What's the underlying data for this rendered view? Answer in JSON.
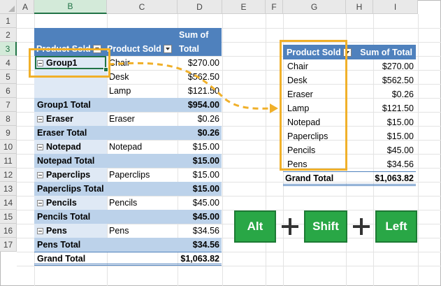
{
  "columns": [
    "A",
    "B",
    "C",
    "D",
    "E",
    "F",
    "G",
    "H",
    "I"
  ],
  "rows": [
    "1",
    "2",
    "3",
    "4",
    "5",
    "6",
    "7",
    "8",
    "9",
    "10",
    "11",
    "12",
    "13",
    "14",
    "15",
    "16",
    "17"
  ],
  "pivot1": {
    "header_row_label": "Product Sold",
    "header_col_label": "Product Sold",
    "header_value_label_1": "Sum of",
    "header_value_label_2": "Total",
    "rows": [
      {
        "b": "Group1",
        "c": "Chair",
        "d": "$270.00",
        "kind": "group"
      },
      {
        "b": "",
        "c": "Desk",
        "d": "$562.50",
        "kind": "item"
      },
      {
        "b": "",
        "c": "Lamp",
        "d": "$121.50",
        "kind": "item"
      },
      {
        "b": "Group1 Total",
        "c": "",
        "d": "$954.00",
        "kind": "total"
      },
      {
        "b": "Eraser",
        "c": "Eraser",
        "d": "$0.26",
        "kind": "group"
      },
      {
        "b": "Eraser Total",
        "c": "",
        "d": "$0.26",
        "kind": "total"
      },
      {
        "b": "Notepad",
        "c": "Notepad",
        "d": "$15.00",
        "kind": "group"
      },
      {
        "b": "Notepad Total",
        "c": "",
        "d": "$15.00",
        "kind": "total"
      },
      {
        "b": "Paperclips",
        "c": "Paperclips",
        "d": "$15.00",
        "kind": "group"
      },
      {
        "b": "Paperclips Total",
        "c": "",
        "d": "$15.00",
        "kind": "total"
      },
      {
        "b": "Pencils",
        "c": "Pencils",
        "d": "$45.00",
        "kind": "group"
      },
      {
        "b": "Pencils Total",
        "c": "",
        "d": "$45.00",
        "kind": "total"
      },
      {
        "b": "Pens",
        "c": "Pens",
        "d": "$34.56",
        "kind": "group"
      },
      {
        "b": "Pens Total",
        "c": "",
        "d": "$34.56",
        "kind": "total"
      },
      {
        "b": "Grand Total",
        "c": "",
        "d": "$1,063.82",
        "kind": "grand"
      }
    ]
  },
  "pivot2": {
    "header_row_label": "Product Sold",
    "header_value_label": "Sum of Total",
    "rows": [
      {
        "label": "Chair",
        "value": "$270.00"
      },
      {
        "label": "Desk",
        "value": "$562.50"
      },
      {
        "label": "Eraser",
        "value": "$0.26"
      },
      {
        "label": "Lamp",
        "value": "$121.50"
      },
      {
        "label": "Notepad",
        "value": "$15.00"
      },
      {
        "label": "Paperclips",
        "value": "$15.00"
      },
      {
        "label": "Pencils",
        "value": "$45.00"
      },
      {
        "label": "Pens",
        "value": "$34.56"
      }
    ],
    "grand_label": "Grand Total",
    "grand_value": "$1,063.82"
  },
  "shortcut": {
    "key1": "Alt",
    "key2": "Shift",
    "key3": "Left"
  },
  "colors": {
    "accent": "#f0b02a",
    "pivot_header": "#4f81bd",
    "key": "#29a746",
    "excel_green": "#217346"
  }
}
